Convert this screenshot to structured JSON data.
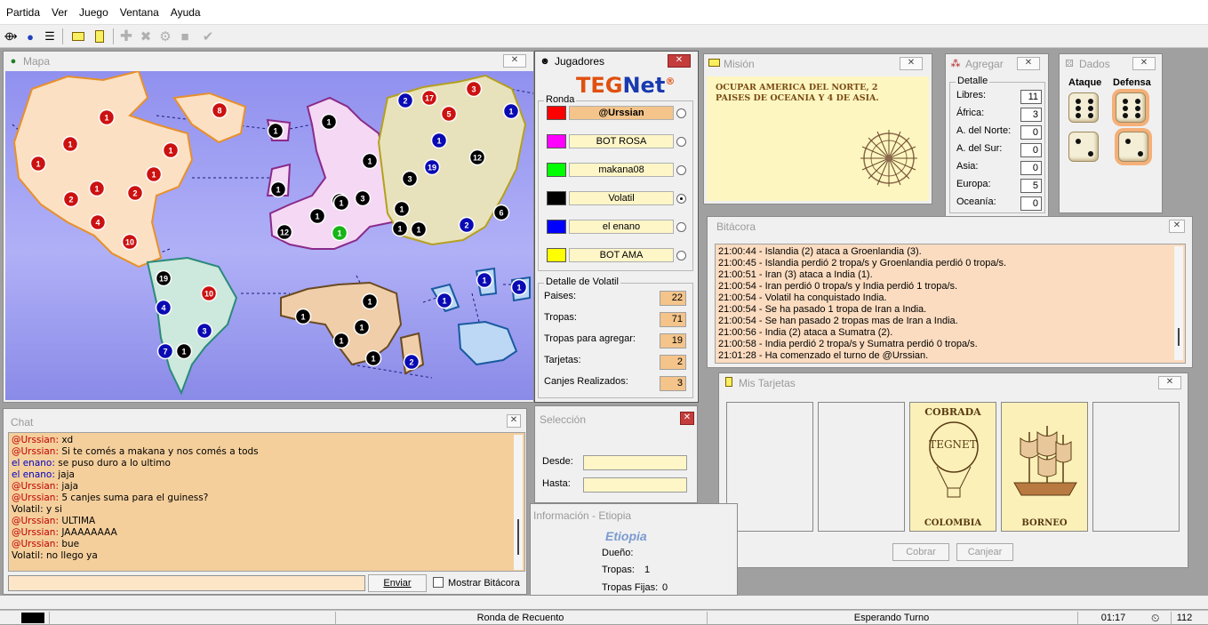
{
  "menu": [
    "Partida",
    "Ver",
    "Juego",
    "Ventana",
    "Ayuda"
  ],
  "toolbar_icons": [
    "connect-icon",
    "globe-icon",
    "list-icon",
    "mission-icon",
    "card-icon",
    "add-icon",
    "attack-icon",
    "regroup-icon",
    "cards-icon",
    "end-turn-icon"
  ],
  "mapa": {
    "title": "Mapa"
  },
  "map_countries": [
    {
      "n": "1",
      "c": "#cc1111"
    },
    {
      "n": "8",
      "c": "#cc1111"
    },
    {
      "n": "1",
      "c": "#cc1111"
    },
    {
      "n": "1",
      "c": "#cc1111"
    },
    {
      "n": "2",
      "c": "#cc1111"
    },
    {
      "n": "1",
      "c": "#cc1111"
    },
    {
      "n": "2",
      "c": "#cc1111"
    },
    {
      "n": "1",
      "c": "#cc1111"
    },
    {
      "n": "1",
      "c": "#cc1111"
    },
    {
      "n": "4",
      "c": "#cc1111"
    },
    {
      "n": "10",
      "c": "#cc1111"
    },
    {
      "n": "19",
      "c": "#000000"
    },
    {
      "n": "10",
      "c": "#cc1111"
    },
    {
      "n": "4",
      "c": "#0a0ab4"
    },
    {
      "n": "3",
      "c": "#0a0ab4"
    },
    {
      "n": "7",
      "c": "#0a0ab4"
    },
    {
      "n": "1",
      "c": "#000000"
    },
    {
      "n": "1",
      "c": "#000000"
    },
    {
      "n": "1",
      "c": "#000000"
    },
    {
      "n": "1",
      "c": "#000000"
    },
    {
      "n": "1",
      "c": "#000000"
    },
    {
      "n": "1",
      "c": "#000000"
    },
    {
      "n": "1",
      "c": "#000000"
    },
    {
      "n": "1",
      "c": "#000000"
    },
    {
      "n": "3",
      "c": "#000000"
    },
    {
      "n": "12",
      "c": "#000000"
    },
    {
      "n": "1",
      "c": "#18b418"
    },
    {
      "n": "2",
      "c": "#0a0ab4"
    },
    {
      "n": "17",
      "c": "#cc1111"
    },
    {
      "n": "5",
      "c": "#cc1111"
    },
    {
      "n": "3",
      "c": "#cc1111"
    },
    {
      "n": "1",
      "c": "#0a0ab4"
    },
    {
      "n": "1",
      "c": "#0a0ab4"
    },
    {
      "n": "19",
      "c": "#0a0ab4"
    },
    {
      "n": "12",
      "c": "#000000"
    },
    {
      "n": "3",
      "c": "#000000"
    },
    {
      "n": "1",
      "c": "#000000"
    },
    {
      "n": "1",
      "c": "#000000"
    },
    {
      "n": "1",
      "c": "#000000"
    },
    {
      "n": "2",
      "c": "#0a0ab4"
    },
    {
      "n": "6",
      "c": "#000000"
    },
    {
      "n": "1",
      "c": "#000000"
    },
    {
      "n": "1",
      "c": "#000000"
    },
    {
      "n": "1",
      "c": "#000000"
    },
    {
      "n": "1",
      "c": "#000000"
    },
    {
      "n": "1",
      "c": "#000000"
    },
    {
      "n": "2",
      "c": "#0a0ab4"
    },
    {
      "n": "1",
      "c": "#0a0ab4"
    },
    {
      "n": "1",
      "c": "#0a0ab4"
    },
    {
      "n": "1",
      "c": "#0a0ab4"
    }
  ],
  "jugadores": {
    "title": "Jugadores",
    "logo_a": "TEG",
    "logo_b": "Net",
    "logo_mark": "®",
    "ronda_label": "Ronda",
    "players": [
      {
        "name": "@Urssian",
        "color": "#ff0000"
      },
      {
        "name": "BOT ROSA",
        "color": "#ff00ff"
      },
      {
        "name": "makana08",
        "color": "#00ff00"
      },
      {
        "name": "Volatil",
        "color": "#000000"
      },
      {
        "name": "el enano",
        "color": "#0000ff"
      },
      {
        "name": "BOT AMA",
        "color": "#ffff00"
      }
    ],
    "detail_title": "Detalle de Volatil",
    "paises_label": "Paises:",
    "paises": "22",
    "tropas_label": "Tropas:",
    "tropas": "71",
    "agregar_label": "Tropas para agregar:",
    "agregar": "19",
    "tarjetas_label": "Tarjetas:",
    "tarjetas": "2",
    "canjes_label": "Canjes Realizados:",
    "canjes": "3"
  },
  "mision": {
    "title": "Misión",
    "text": "OCUPAR AMERICA DEL NORTE, 2 PAISES DE OCEANIA Y 4 DE ASIA."
  },
  "agregar": {
    "title": "Agregar",
    "group": "Detalle",
    "rows": [
      {
        "label": "Libres:",
        "value": "11"
      },
      {
        "label": "África:",
        "value": "3"
      },
      {
        "label": "A. del Norte:",
        "value": "0"
      },
      {
        "label": "A. del Sur:",
        "value": "0"
      },
      {
        "label": "Asia:",
        "value": "0"
      },
      {
        "label": "Europa:",
        "value": "5"
      },
      {
        "label": "Oceanía:",
        "value": "0"
      }
    ]
  },
  "dados": {
    "title": "Dados",
    "ataque": "Ataque",
    "defensa": "Defensa",
    "ataque_values": [
      6,
      2
    ],
    "defensa_values": [
      6,
      2
    ]
  },
  "bitacora": {
    "title": "Bitácora",
    "lines": [
      "21:00:44 - Islandia (2) ataca a Groenlandia (3).",
      "21:00:45 - Islandia perdió 2 tropa/s y Groenlandia perdió 0 tropa/s.",
      "21:00:51 - Iran (3) ataca a India (1).",
      "21:00:54 - Iran perdió 0 tropa/s y India perdió 1 tropa/s.",
      "21:00:54 - Volatil ha conquistado India.",
      "21:00:54 - Se ha pasado 1 tropa de Iran a India.",
      "21:00:54 - Se han pasado 2 tropas mas de Iran a India.",
      "21:00:56 - India (2) ataca a Sumatra (2).",
      "21:00:58 - India perdió 2 tropa/s y Sumatra perdió 0 tropa/s.",
      "21:01:28 - Ha comenzado el turno de @Urssian."
    ]
  },
  "tarjetas": {
    "title": "Mis Tarjetas",
    "cards": [
      {
        "top": "COBRADA",
        "logo": "TEGNET",
        "bottom": "COLOMBIA"
      },
      {
        "top": "",
        "logo": "",
        "bottom": "BORNEO"
      }
    ],
    "cobrar": "Cobrar",
    "canjear": "Canjear"
  },
  "chat": {
    "title": "Chat",
    "lines": [
      {
        "author": "@Urssian:",
        "kind": "red",
        "text": " xd"
      },
      {
        "author": "@Urssian:",
        "kind": "red",
        "text": " Si te comés a makana y nos comés a tods"
      },
      {
        "author": "el enano:",
        "kind": "blue",
        "text": " se puso duro a lo ultimo"
      },
      {
        "author": "el enano:",
        "kind": "blue",
        "text": " jaja"
      },
      {
        "author": "@Urssian:",
        "kind": "red",
        "text": " jaja"
      },
      {
        "author": "@Urssian:",
        "kind": "red",
        "text": " 5 canjes suma para el guiness?"
      },
      {
        "author": "Volatil:",
        "kind": "black",
        "text": " y si"
      },
      {
        "author": "@Urssian:",
        "kind": "red",
        "text": " ULTIMA"
      },
      {
        "author": "@Urssian:",
        "kind": "red",
        "text": " JAAAAAAAA"
      },
      {
        "author": "@Urssian:",
        "kind": "red",
        "text": " bue"
      },
      {
        "author": "Volatil:",
        "kind": "black",
        "text": " no llego ya"
      }
    ],
    "input_value": "",
    "send": "Enviar",
    "mostrar": "Mostrar Bitácora"
  },
  "seleccion": {
    "title": "Selección",
    "desde": "Desde:",
    "hasta": "Hasta:"
  },
  "informacion": {
    "title": "Información - Etiopia",
    "country": "Etiopia",
    "dueno_label": "Dueño:",
    "dueno": "",
    "tropas_label": "Tropas:",
    "tropas": "1",
    "fijas_label": "Tropas Fijas:",
    "fijas": "0"
  },
  "status": {
    "ronda": "Ronda de Recuento",
    "estado": "Esperando Turno",
    "time": "01:17",
    "count": "112"
  }
}
